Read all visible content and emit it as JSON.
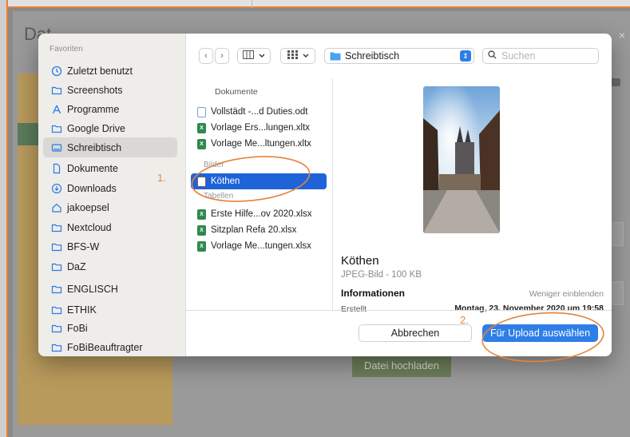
{
  "background": {
    "title": "Dat              ",
    "close_icon": "×",
    "upload_button": "Datei hochladen"
  },
  "dialog": {
    "sidebar": {
      "heading": "Favoriten",
      "items": [
        {
          "label": "Zuletzt benutzt",
          "icon": "clock-icon"
        },
        {
          "label": "Screenshots",
          "icon": "folder-icon"
        },
        {
          "label": "Programme",
          "icon": "apps-icon"
        },
        {
          "label": "Google Drive",
          "icon": "folder-icon"
        },
        {
          "label": "Schreibtisch",
          "icon": "desktop-icon",
          "selected": true
        },
        {
          "label": "Dokumente",
          "icon": "document-icon"
        },
        {
          "label": "Downloads",
          "icon": "download-icon"
        },
        {
          "label": "jakoepsel",
          "icon": "home-icon"
        },
        {
          "label": "Nextcloud",
          "icon": "folder-icon"
        },
        {
          "label": "BFS-W",
          "icon": "folder-icon"
        },
        {
          "label": "DaZ",
          "icon": "folder-icon"
        },
        {
          "label": "ENGLISCH",
          "icon": "folder-icon"
        },
        {
          "label": "ETHIK",
          "icon": "folder-icon"
        },
        {
          "label": "FoBi",
          "icon": "folder-icon"
        },
        {
          "label": "FoBiBeauftragter",
          "icon": "folder-icon"
        }
      ]
    },
    "toolbar": {
      "back_icon": "‹",
      "forward_icon": "›",
      "location": "Schreibtisch",
      "search_placeholder": "Suchen"
    },
    "files": {
      "header": "Dokumente",
      "documents": [
        {
          "name": "Vollstädt -...d Duties.odt",
          "type": "odt"
        },
        {
          "name": "Vorlage Ers...lungen.xltx",
          "type": "xls"
        },
        {
          "name": "Vorlage Me...ltungen.xltx",
          "type": "xls"
        }
      ],
      "section_images": "Bilder",
      "images": [
        {
          "name": "Köthen",
          "type": "img",
          "selected": true
        }
      ],
      "section_tables": "Tabellen",
      "tables": [
        {
          "name": "Erste Hilfe...ov 2020.xlsx",
          "type": "xls"
        },
        {
          "name": "Sitzplan Refa 20.xlsx",
          "type": "xls"
        },
        {
          "name": "Vorlage Me...tungen.xlsx",
          "type": "xls"
        }
      ]
    },
    "preview": {
      "name": "Köthen",
      "kind": "JPEG-Bild - 100 KB",
      "info_heading": "Informationen",
      "show_less": "Weniger einblenden",
      "created_label": "Erstellt",
      "created_value": "Montag, 23. November 2020 um 19:58"
    },
    "buttons": {
      "cancel": "Abbrechen",
      "confirm": "Für Upload auswählen"
    }
  },
  "annotations": {
    "step1": "1.",
    "step2": "2."
  },
  "colors": {
    "accent": "#2f7ee8",
    "selection": "#1f63d9",
    "annotation": "#e5833a",
    "sidebar_bg": "#eeedea"
  }
}
